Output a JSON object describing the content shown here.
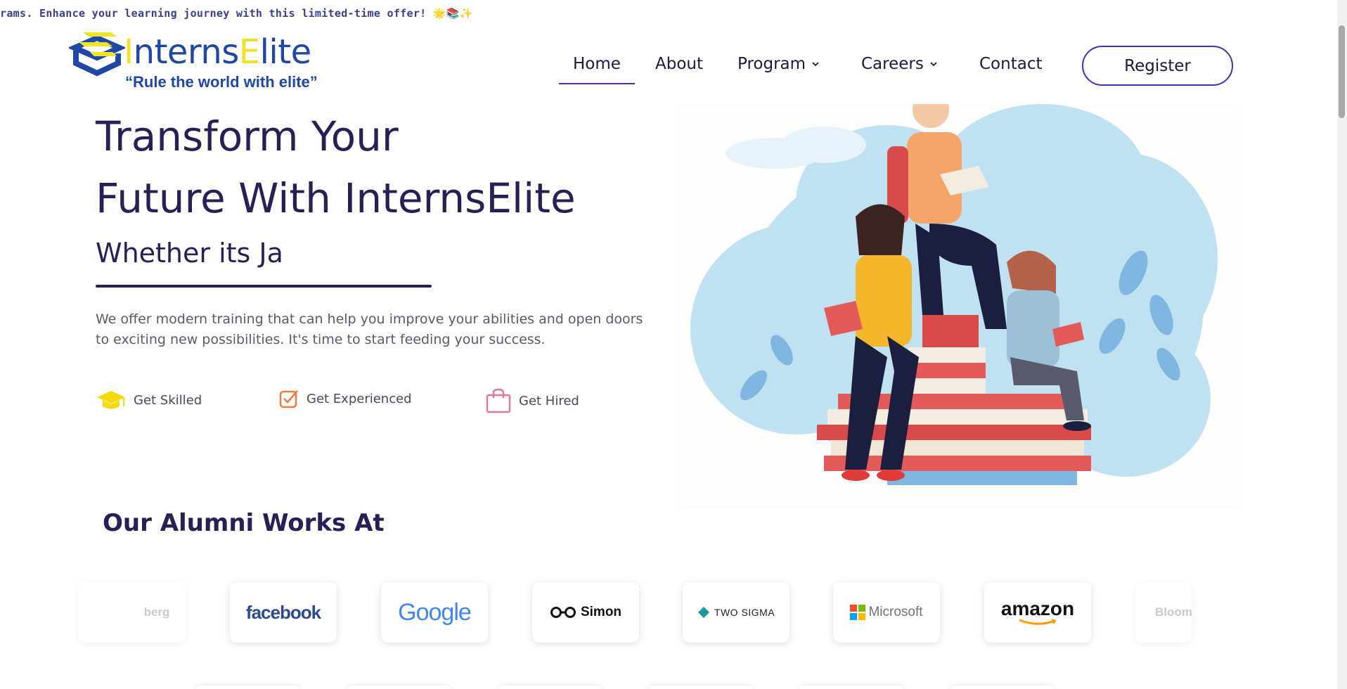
{
  "ticker": {
    "text": "rams. Enhance your learning journey with this limited-time offer! 🌟📚✨"
  },
  "logo": {
    "brand_prefix": "I",
    "brand_mid": "nterns",
    "brand_e": "E",
    "brand_suffix": "lite",
    "tagline": "“Rule the world with elite”"
  },
  "nav": {
    "home": "Home",
    "about": "About",
    "program": "Program",
    "careers": "Careers",
    "contact": "Contact",
    "register": "Register"
  },
  "hero": {
    "title_line1": "Transform Your",
    "title_line2": "Future With InternsElite",
    "subtitle": "Whether its Ja",
    "description": "We offer modern training that can help you improve your abilities and open doors to exciting new possibilities. It's time to start feeding your success.",
    "features": [
      {
        "label": "Get Skilled",
        "icon": "graduation-cap-icon",
        "color": "#f5d90a"
      },
      {
        "label": "Get Experienced",
        "icon": "checkbox-icon",
        "color": "#f07b3f"
      },
      {
        "label": "Get Hired",
        "icon": "shopping-bag-icon",
        "color": "#e07a9a"
      }
    ]
  },
  "alumni": {
    "title": "Our Alumni Works At",
    "companies": [
      "berg",
      "facebook",
      "Google",
      "Simon",
      "TWO SIGMA",
      "Microsoft",
      "amazon",
      "Bloom"
    ]
  },
  "colors": {
    "primary": "#281f55",
    "accent": "#3a34b8",
    "brand_blue": "#1f47a6",
    "brand_yellow": "#f2e12a"
  }
}
